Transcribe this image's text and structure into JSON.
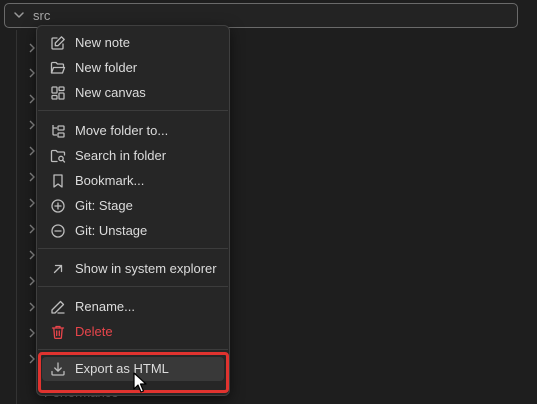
{
  "folder": {
    "name": "src",
    "chevron_icon": "chevron-down-icon"
  },
  "tree": {
    "partial_item_label": "Performance"
  },
  "menu": {
    "items": [
      {
        "label": "New note",
        "icon": "edit-icon"
      },
      {
        "label": "New folder",
        "icon": "folder-open-icon"
      },
      {
        "label": "New canvas",
        "icon": "layout-dashboard-icon"
      },
      {
        "label": "Move folder to...",
        "icon": "folder-tree-icon"
      },
      {
        "label": "Search in folder",
        "icon": "folder-search-icon"
      },
      {
        "label": "Bookmark...",
        "icon": "bookmark-icon"
      },
      {
        "label": "Git: Stage",
        "icon": "plus-circle-icon"
      },
      {
        "label": "Git: Unstage",
        "icon": "minus-circle-icon"
      },
      {
        "label": "Show in system explorer",
        "icon": "arrow-up-right-icon"
      },
      {
        "label": "Rename...",
        "icon": "pencil-icon"
      },
      {
        "label": "Delete",
        "icon": "trash-icon",
        "danger": true
      },
      {
        "label": "Export as HTML",
        "icon": "download-icon",
        "hovered": true
      }
    ]
  },
  "colors": {
    "background": "#1e1e1e",
    "menu_background": "#262626",
    "text": "#dcdcdc",
    "danger": "#e8454b",
    "highlight_outline": "#e0332f"
  }
}
